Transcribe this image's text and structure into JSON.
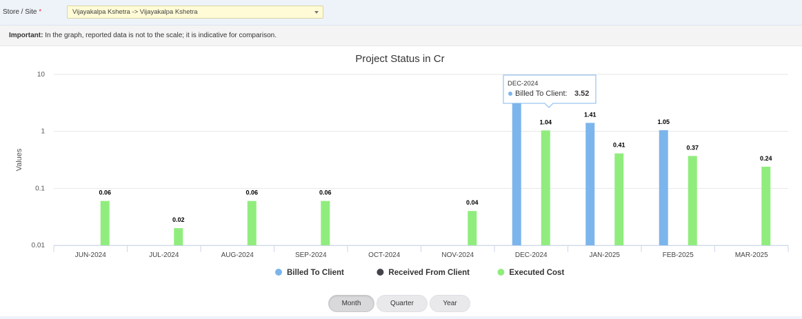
{
  "header": {
    "site_label": "Store / Site",
    "required_mark": "*",
    "site_value": "Vijayakalpa Kshetra -> Vijayakalpa Kshetra"
  },
  "notice": {
    "strong": "Important:",
    "text": " In the graph, reported data is not to the scale; it is indicative for comparison."
  },
  "chart_data": {
    "type": "bar",
    "title": "Project Status in Cr",
    "ylabel": "Values",
    "xlabel": "",
    "yscale": "log",
    "ylim": [
      0.01,
      10
    ],
    "yticks": [
      "10",
      "1",
      "0.1",
      "0.01"
    ],
    "grid": true,
    "legend": "bottom",
    "categories": [
      "JUN-2024",
      "JUL-2024",
      "AUG-2024",
      "SEP-2024",
      "OCT-2024",
      "NOV-2024",
      "DEC-2024",
      "JAN-2025",
      "FEB-2025",
      "MAR-2025"
    ],
    "series": [
      {
        "name": "Billed To Client",
        "color": "#7cb5ec",
        "values": [
          null,
          null,
          null,
          null,
          null,
          null,
          3.52,
          1.41,
          1.05,
          null
        ]
      },
      {
        "name": "Received From Client",
        "color": "#434348",
        "values": [
          null,
          null,
          null,
          null,
          null,
          null,
          null,
          null,
          null,
          null
        ]
      },
      {
        "name": "Executed Cost",
        "color": "#90ed7d",
        "values": [
          0.06,
          0.02,
          0.06,
          0.06,
          null,
          0.04,
          1.04,
          0.41,
          0.37,
          0.24
        ]
      }
    ],
    "tooltip": {
      "category": "DEC-2024",
      "series": "Billed To Client",
      "label": "Billed To Client:",
      "value": "3.52"
    }
  },
  "period_buttons": [
    {
      "label": "Month",
      "active": true
    },
    {
      "label": "Quarter",
      "active": false
    },
    {
      "label": "Year",
      "active": false
    }
  ]
}
